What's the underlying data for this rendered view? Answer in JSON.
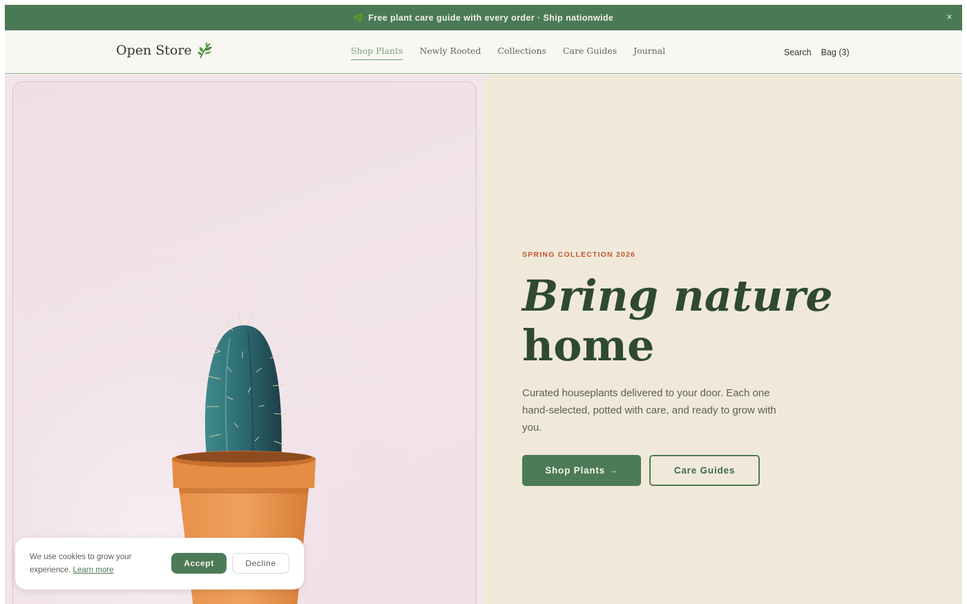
{
  "announcement": {
    "leaf_icon": "leaf-icon",
    "text": "Free plant care guide with every order · Ship nationwide",
    "close_glyph": "×"
  },
  "header": {
    "logo_text": "Open Store",
    "logo_icon": "leaf-sprig-icon",
    "nav": [
      {
        "label": "Shop Plants",
        "active": true
      },
      {
        "label": "Newly Rooted",
        "active": false
      },
      {
        "label": "Collections",
        "active": false
      },
      {
        "label": "Care Guides",
        "active": false
      },
      {
        "label": "Journal",
        "active": false
      }
    ],
    "search_label": "Search",
    "bag_label": "Bag (3)"
  },
  "hero": {
    "eyebrow": "SPRING COLLECTION 2026",
    "headline_line1": "Bring nature",
    "headline_line2": "home",
    "subtext": "Curated houseplants delivered to your door. Each one hand-selected, potted with care, and ready to grow with you.",
    "primary_cta": "Shop Plants",
    "primary_cta_arrow": "→",
    "secondary_cta": "Care Guides"
  },
  "cookie": {
    "text": "We use cookies to grow your experience.",
    "learn_more": "Learn more",
    "accept": "Accept",
    "decline": "Decline"
  },
  "colors": {
    "brand_green": "#4a7a55",
    "accent_orange": "#c2562e",
    "hero_right_bg": "#f0e9da",
    "hero_left_bg": "#f3e6ea"
  }
}
